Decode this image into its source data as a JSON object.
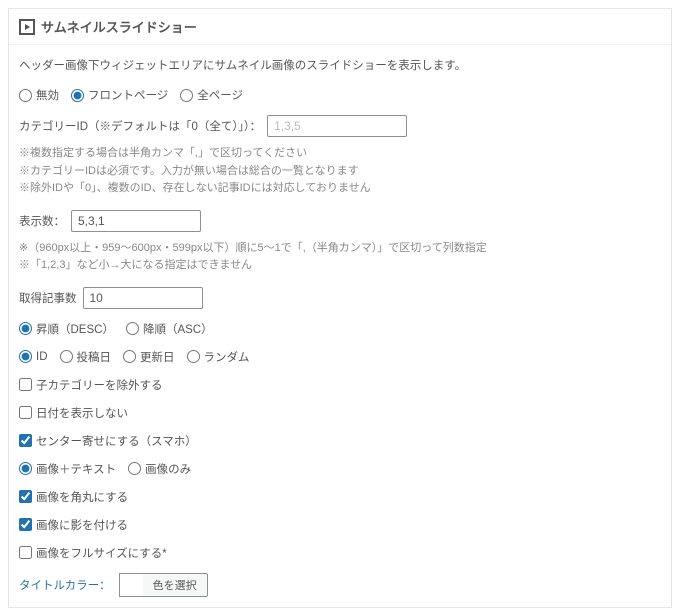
{
  "panel": {
    "title": "サムネイルスライドショー",
    "description": "ヘッダー画像下ウィジェットエリアにサムネイル画像のスライドショーを表示します。"
  },
  "display_scope": {
    "options": [
      {
        "id": "none",
        "label": "無効"
      },
      {
        "id": "front",
        "label": "フロントページ"
      },
      {
        "id": "all",
        "label": "全ページ"
      }
    ],
    "selected": "front"
  },
  "category_id": {
    "label": "カテゴリーID（※デフォルトは「0（全て）」）：",
    "placeholder": "1,3,5",
    "value": ""
  },
  "category_notes": [
    "※複数指定する場合は半角カンマ「,」で区切ってください",
    "※カテゴリーIDは必須です。入力が無い場合は総合の一覧となります",
    "※除外IDや「0」、複数のID、存在しない記事IDには対応しておりません"
  ],
  "display_count": {
    "label": "表示数：",
    "value": "5,3,1"
  },
  "display_count_notes": [
    "※（960px以上・959〜600px・599px以下）順に5〜1で「,（半角カンマ）」で区切って列数指定",
    "※「1,2,3」など小→大になる指定はできません"
  ],
  "fetch_count": {
    "label": "取得記事数",
    "value": "10"
  },
  "order": {
    "options": [
      {
        "id": "desc",
        "label": "昇順（DESC）"
      },
      {
        "id": "asc",
        "label": "降順（ASC）"
      }
    ],
    "selected": "desc"
  },
  "orderby": {
    "options": [
      {
        "id": "id",
        "label": "ID"
      },
      {
        "id": "date",
        "label": "投稿日"
      },
      {
        "id": "modified",
        "label": "更新日"
      },
      {
        "id": "rand",
        "label": "ランダム"
      }
    ],
    "selected": "id"
  },
  "checkboxes": {
    "exclude_child_cat": {
      "label": "子カテゴリーを除外する",
      "checked": false
    },
    "hide_date": {
      "label": "日付を表示しない",
      "checked": false
    },
    "center_sp": {
      "label": "センター寄せにする（スマホ）",
      "checked": true
    }
  },
  "thumb_mode": {
    "options": [
      {
        "id": "img_text",
        "label": "画像＋テキスト"
      },
      {
        "id": "img_only",
        "label": "画像のみ"
      }
    ],
    "selected": "img_text"
  },
  "checkboxes2": {
    "round": {
      "label": "画像を角丸にする",
      "checked": true
    },
    "shadow": {
      "label": "画像に影を付ける",
      "checked": true
    },
    "fullsize": {
      "label": "画像をフルサイズにする*",
      "checked": false
    }
  },
  "title_color": {
    "label": "タイトルカラー：",
    "button": "色を選択"
  }
}
